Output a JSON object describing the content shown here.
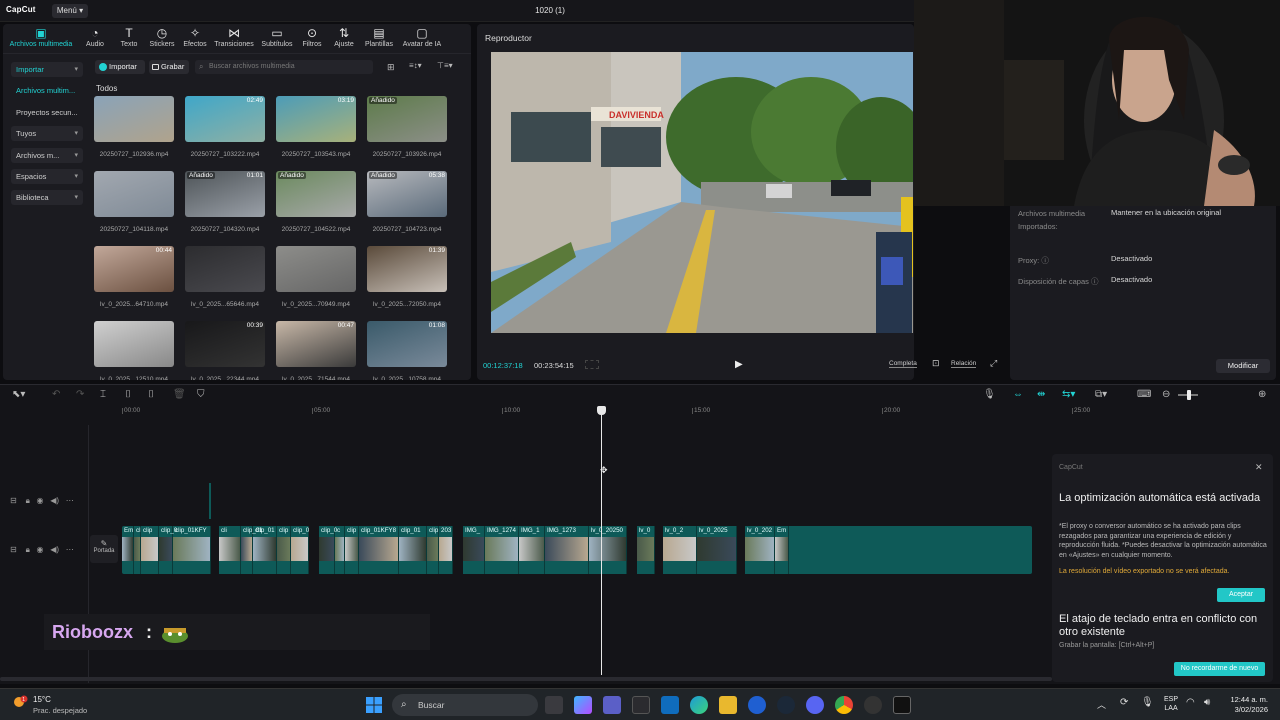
{
  "app": {
    "logo": "CapCut",
    "menu_label": "Menú",
    "project_title": "1020 (1)"
  },
  "toolbar": [
    {
      "label": "Archivos multimedia",
      "icon": "media-icon",
      "active": true
    },
    {
      "label": "Audio",
      "icon": "audio-icon"
    },
    {
      "label": "Texto",
      "icon": "text-icon"
    },
    {
      "label": "Stickers",
      "icon": "sticker-icon"
    },
    {
      "label": "Efectos",
      "icon": "effects-icon"
    },
    {
      "label": "Transiciones",
      "icon": "transition-icon"
    },
    {
      "label": "Subtítulos",
      "icon": "captions-icon"
    },
    {
      "label": "Filtros",
      "icon": "filters-icon"
    },
    {
      "label": "Ajuste",
      "icon": "adjust-icon"
    },
    {
      "label": "Plantillas",
      "icon": "templates-icon"
    },
    {
      "label": "Avatar de IA",
      "icon": "ai-avatar-icon"
    }
  ],
  "sidebar": [
    {
      "label": "Importar"
    },
    {
      "label": "Archivos multim..."
    },
    {
      "label": "Proyectos secun..."
    },
    {
      "label": "Tuyos"
    },
    {
      "label": "Archivos m..."
    },
    {
      "label": "Espacios"
    },
    {
      "label": "Biblioteca"
    }
  ],
  "media": {
    "import_label": "Importar",
    "record_label": "Grabar",
    "search_placeholder": "Buscar archivos multimedia",
    "section_label": "Todos",
    "items": [
      {
        "name": "20250727_102936.mp4",
        "badge": "",
        "duration": ""
      },
      {
        "name": "20250727_103222.mp4",
        "badge": "",
        "duration": "02:49"
      },
      {
        "name": "20250727_103543.mp4",
        "badge": "",
        "duration": "03:19"
      },
      {
        "name": "20250727_103926.mp4",
        "badge": "Añadido",
        "duration": ""
      },
      {
        "name": "20250727_104118.mp4",
        "badge": "",
        "duration": ""
      },
      {
        "name": "20250727_104320.mp4",
        "badge": "Añadido",
        "duration": "01:01"
      },
      {
        "name": "20250727_104522.mp4",
        "badge": "Añadido",
        "duration": ""
      },
      {
        "name": "20250727_104723.mp4",
        "badge": "Añadido",
        "duration": "05:38"
      },
      {
        "name": "lv_0_2025...64710.mp4",
        "badge": "",
        "duration": "00:44"
      },
      {
        "name": "lv_0_2025...65646.mp4",
        "badge": "",
        "duration": ""
      },
      {
        "name": "lv_0_2025...70949.mp4",
        "badge": "",
        "duration": ""
      },
      {
        "name": "lv_0_2025...72050.mp4",
        "badge": "",
        "duration": "01:39"
      },
      {
        "name": "lv_0_2025...12510.mp4",
        "badge": "",
        "duration": ""
      },
      {
        "name": "lv_0_2025...22344.mp4",
        "badge": "",
        "duration": "00:39"
      },
      {
        "name": "lv_0_2025...71544.mp4",
        "badge": "",
        "duration": "00:47"
      },
      {
        "name": "lv_0_2025...10758.mp4",
        "badge": "",
        "duration": "01:08"
      }
    ]
  },
  "player": {
    "title": "Reproductor",
    "time_current": "00:12:37:18",
    "time_total": "00:23:54:15",
    "full_label": "Completa",
    "ratio_label": "Relación"
  },
  "properties": {
    "rows": [
      {
        "key": "Archivos multimedia",
        "value": "Mantener en la ubicación original"
      },
      {
        "key": "Importados:",
        "value": ""
      },
      {
        "key": "Proxy:",
        "value": "Desactivado"
      },
      {
        "key": "Disposición de capas",
        "value": "Desactivado"
      }
    ],
    "modify_label": "Modificar"
  },
  "timeline": {
    "ruler": [
      "00:00",
      "05:00",
      "10:00",
      "15:00",
      "20:00",
      "25:00"
    ],
    "cover_label": "Portada",
    "clips": [
      {
        "label": "Em"
      },
      {
        "label": "cl"
      },
      {
        "label": "clip"
      },
      {
        "label": "clip_0"
      },
      {
        "label": "clip_01KFY"
      },
      {
        "label": "cli"
      },
      {
        "label": "clip_01"
      },
      {
        "label": "clip_01"
      },
      {
        "label": "clip"
      },
      {
        "label": "clip_0"
      },
      {
        "label": "clip_0"
      },
      {
        "label": "c"
      },
      {
        "label": "clip"
      },
      {
        "label": "clip_01KFY8"
      },
      {
        "label": "clip_01"
      },
      {
        "label": "clip"
      },
      {
        "label": "203"
      },
      {
        "label": "IMG_"
      },
      {
        "label": "IMG_1274"
      },
      {
        "label": "IMG_1"
      },
      {
        "label": "IMG_1273"
      },
      {
        "label": "lv_0_20250"
      },
      {
        "label": "lv_0"
      },
      {
        "label": "lv_0_2"
      },
      {
        "label": "lv_0_2025"
      },
      {
        "label": "lv_0_202"
      },
      {
        "label": "Em"
      }
    ]
  },
  "notification": {
    "app_name": "CapCut",
    "title1": "La optimización automática está activada",
    "body": "*El proxy o conversor automático se ha activado para clips rezagados para garantizar una experiencia de edición y reproducción fluida. *Puedes desactivar la optimización automática en «Ajustes» en cualquier momento.",
    "warning": "La resolución del vídeo exportado no se verá afectada.",
    "accept_label": "Aceptar",
    "title2": "El atajo de teclado entra en conflicto con otro existente",
    "shortcut": "Grabar la pantalla: [Ctrl+Alt+P]",
    "no_remind_label": "No recordarme de nuevo"
  },
  "chat": {
    "username": "Rioboozx",
    "separator": ":"
  },
  "taskbar": {
    "weather_temp": "15°C",
    "weather_desc": "Prac. despejado",
    "search_label": "Buscar",
    "lang_top": "ESP",
    "lang_bottom": "LAA",
    "time": "12:44 a. m.",
    "date": "3/02/2026"
  }
}
